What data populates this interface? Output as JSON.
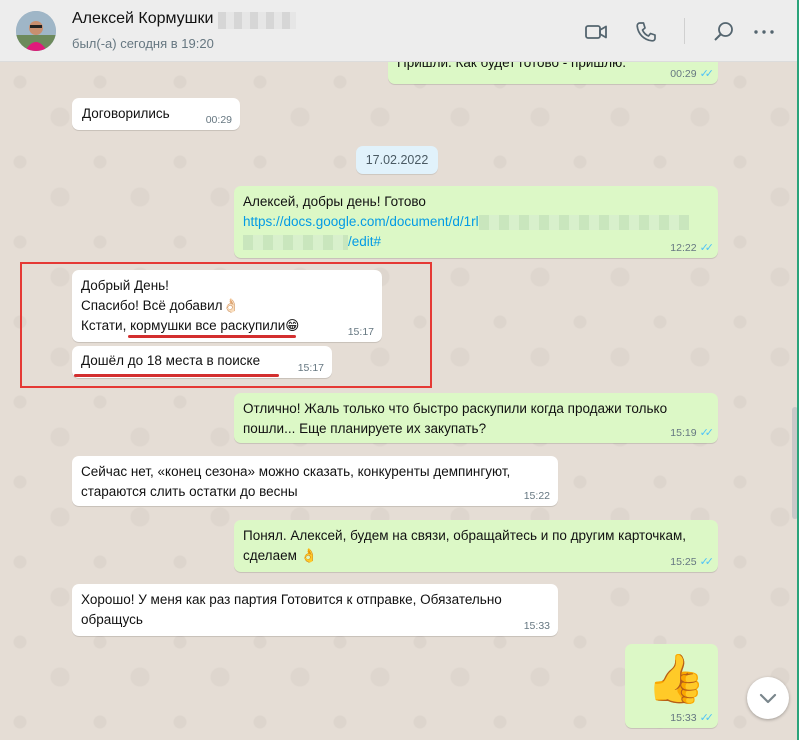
{
  "header": {
    "contact_name": "Алексей Кормушки",
    "last_seen": "был(-а) сегодня в 19:20"
  },
  "icons": [
    "video-call-icon",
    "voice-call-icon",
    "search-icon",
    "menu-icon",
    "chevron-down-icon"
  ],
  "colors": {
    "outgoing_bubble": "#dcf8c6",
    "incoming_bubble": "#ffffff",
    "read_ticks": "#4fc3f7",
    "highlight_box": "#e53935",
    "link": "#039be5"
  },
  "messages": {
    "m1": {
      "text": "Пришли. Как будет готово - пришлю.",
      "time": "00:29"
    },
    "m2": {
      "text": "Договорились",
      "time": "00:29"
    },
    "date": "17.02.2022",
    "m3": {
      "line1": "Алексей, добры день! Готово",
      "link_start": "https://docs.google.com/document/d/1rl",
      "link_end": "/edit#",
      "time": "12:22"
    },
    "m4": {
      "line1": "Добрый День!",
      "line2": "Спасибо! Всё добавил",
      "line2_emoji": "👌🏻",
      "line3_prefix": "Кстати, ",
      "line3_underlined": "кормушки все раскупили",
      "line3_emoji": "😁",
      "time": "15:17"
    },
    "m5": {
      "text": "Дошёл до 18 места в поиске",
      "time": "15:17"
    },
    "m6": {
      "line1": "Отлично! Жаль только что быстро раскупили когда продажи только",
      "line2": "пошли... Еще планируете их закупать?",
      "time": "15:19"
    },
    "m7": {
      "line1": "Сейчас нет, «конец сезона» можно сказать, конкуренты демпингуют,",
      "line2": "стараются слить остатки до весны",
      "time": "15:22"
    },
    "m8": {
      "line1": "Понял. Алексей, будем на связи, обращайтесь и по другим карточкам,",
      "line2": "сделаем",
      "line2_emoji": "👌",
      "time": "15:25"
    },
    "m9": {
      "line1": "Хорошо! У меня как раз партия Готовится к отправке, Обязательно",
      "line2": "обращусь",
      "time": "15:33"
    },
    "m10": {
      "emoji": "👍",
      "time": "15:33"
    }
  }
}
